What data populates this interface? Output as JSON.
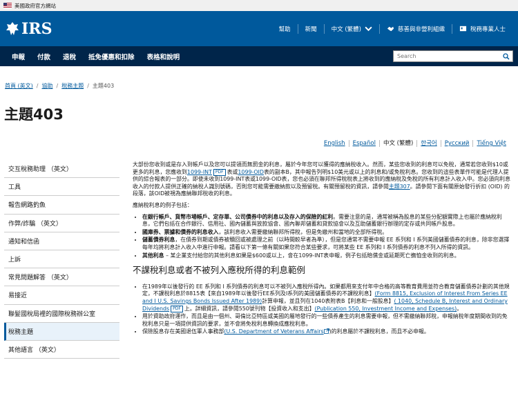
{
  "gov_banner": {
    "text": "美國政府官方網站"
  },
  "header": {
    "logo_text": "IRS",
    "util": {
      "help": "幫助",
      "news": "新聞",
      "language": "中文 (繁體)",
      "charities": "慈善與非營利組織",
      "tax_pros": "稅務專業人士"
    }
  },
  "nav": {
    "items": [
      "申報",
      "付款",
      "退稅",
      "抵免優惠和扣除",
      "表格和說明"
    ],
    "search_placeholder": "Search"
  },
  "breadcrumb": {
    "items": [
      "首頁 (英文)",
      "協助",
      "稅務主題",
      "主題403"
    ]
  },
  "page_title": "主題403",
  "languages": [
    "English",
    "Español",
    "中文 (繁體)",
    "한국어",
    "Русский",
    "Tiếng Việt"
  ],
  "sidenav": {
    "items": [
      "交互稅務助理 （英文）",
      "工具",
      "報告網路釣魚",
      "作弊/詐騙 （英文）",
      "通知和信函",
      "上訴",
      "常見問題解答 （英文）",
      "易接近",
      "聯髮國稅局裡的國際稅務辦公室",
      "稅務主題",
      "其他語言 （英文）"
    ],
    "active_index": 9
  },
  "content": {
    "intro_1": "大部份您收到或是存入到帳戶以及您可以提領而無罰金的利息，屬於今年您可以獲得的應納稅收入。然而，某些您收到的利息可以免稅，通常若您收到$10或更多的利息，您應收到",
    "form_1099int": "1099-INT",
    "pdf_label": "PDF",
    "intro_2": "表或",
    "form_1099oid": "1099-OID",
    "intro_3": "表的副本B，其中報告列明$10美元或以上的利息和/或免稅利息。您收到的這些表單作可能是代理人提供的綜合報表的一部分。即使未收到1099-INT表或1099-OID表，您也必須在聯邦所得稅稅表上將收到的應納稅及免稅的所有利息計入收入中。您必須向利息收入的付款人提供正確的納稅人識別號碼，否則您可能需要繳納款以及預留稅。有關預留稅的資訊，請參閱",
    "topic307": "主題307",
    "intro_4": "。請參閱下面有關原始發行折扣 (OID) 的段落，該OID被視為應納聯邦稅收的利息。",
    "examples_heading": "應納稅利息的例子包括：",
    "bullets_taxable": [
      {
        "bold": "在銀行帳戶、貨幣市場帳戶、定存單、公司債券中的利息以及存入的保險的紅利",
        "text": "。需要注意的是，通常被稱為股息的某些分配額實際上也屬於應納稅利息，它們包括在合作銀行、信用社、國內儲蓄與放款協會、國內聯邦儲蓄和貸款協會以及互助儲蓄銀行辦理的定存或共同帳戶股息。"
      },
      {
        "bold": "國庫券、票據和債券的利息收入",
        "text": "，該利息收入需要繳納聯邦所得稅，但是免繳州和當地的全部所得稅。"
      },
      {
        "bold": "儲蓄債券利息",
        "text": "，在債券到期或債券被贖回或被處理之前（以時間較早者為準），但是您通常不需要申報 EE 系列和 I 系列美國儲蓄債券的利息，除非您選擇每年均將利息計入收入中進行申報。請看以下第一條有關如果您符合某些要求，可將某些 EE 系列和 I 系列債券的利息不列入所得的資訊。"
      },
      {
        "bold": "其他利息",
        "text": " – 某企業支付給您的其他利息如果是$600或以上，會在1099-INT表申報，例子包括賠償金或延期死亡撫恤金收到的利息。"
      }
    ],
    "nontaxable_heading": "不課稅利息或者不被列入應稅所得的利息範例",
    "nt1_a": "在1989年以後發行的 EE 系列和 I 系列債券的利息可以不被列入應稅所得內。如果都用來支付年中合格的高等教育費用並符合教育儲蓄債券計劃的其他規定，不課稅利息於8815表【來自1989年以後發行EE系列及I系列的美國儲蓄債券的不課稅利息】",
    "nt1_link": "(Form 8815, Exclusion of Interest From Series EE and I U.S. Savings Bonds Issued After 1989)",
    "nt1_b": "計算申報，並且列在1040表附表B【利息和一般股息】",
    "nt1_link2": "( 1040, Schedule B, Interest and Ordinary Dividends",
    "nt1_c": "上。詳細資訊，請參閱550號刊物【投資收入和支出】",
    "nt1_link3": "(Publication 550, Investment Income and Expenses)",
    "nt1_d": "。",
    "nt2": "用於資助政府運作，而且是由一個州、哥倫比亞特區或美國的屬地發行的一些債券產生的利息需要申報，但不需繳納聯邦稅，申報納稅年度期間收到的免稅利息只是一項提供資訊的要求，並不會將免稅利息轉換成應稅利息。",
    "nt3_a": "保險股息存在美國退伍軍人事務部",
    "nt3_link": "(U.S. Department of Veterans Affairs",
    "nt3_b": ")的利息屬於不課稅利息，而且不必申報。"
  },
  "colors": {
    "header_blue": "#00599c",
    "nav_navy": "#00254a",
    "link": "#00599c"
  }
}
